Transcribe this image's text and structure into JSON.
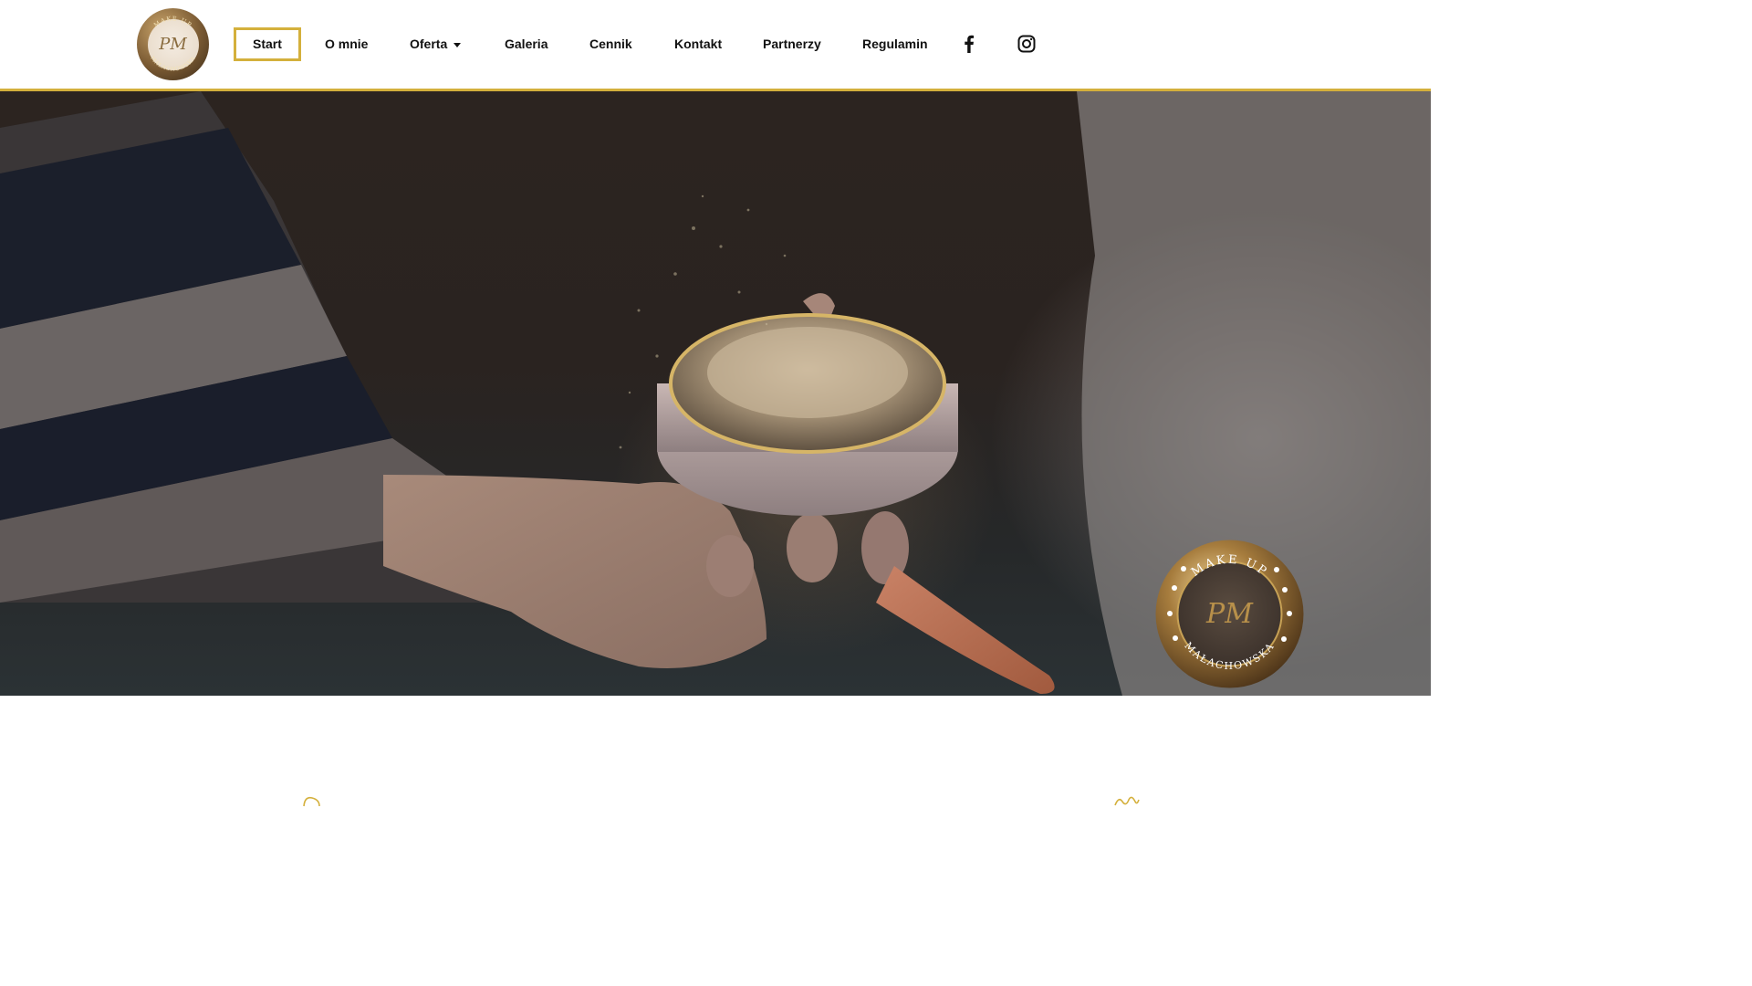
{
  "brand": {
    "logo_monogram": "PM",
    "logo_top_text": "MAKE UP",
    "logo_bottom_text": "MAŁACHOWSKA"
  },
  "nav": {
    "items": [
      {
        "label": "Start",
        "active": true
      },
      {
        "label": "O mnie"
      },
      {
        "label": "Oferta",
        "has_dropdown": true
      },
      {
        "label": "Galeria"
      },
      {
        "label": "Cennik"
      },
      {
        "label": "Kontakt"
      },
      {
        "label": "Partnerzy"
      },
      {
        "label": "Regulamin"
      }
    ],
    "social": [
      {
        "icon": "facebook-icon"
      },
      {
        "icon": "instagram-icon"
      }
    ]
  },
  "hero": {
    "badge_top_text": "MAKE UP",
    "badge_bottom_text": "MAŁACHOWSKA",
    "badge_monogram": "PM"
  },
  "colors": {
    "accent_gold": "#d4b03c",
    "text": "#111111",
    "background": "#ffffff"
  }
}
